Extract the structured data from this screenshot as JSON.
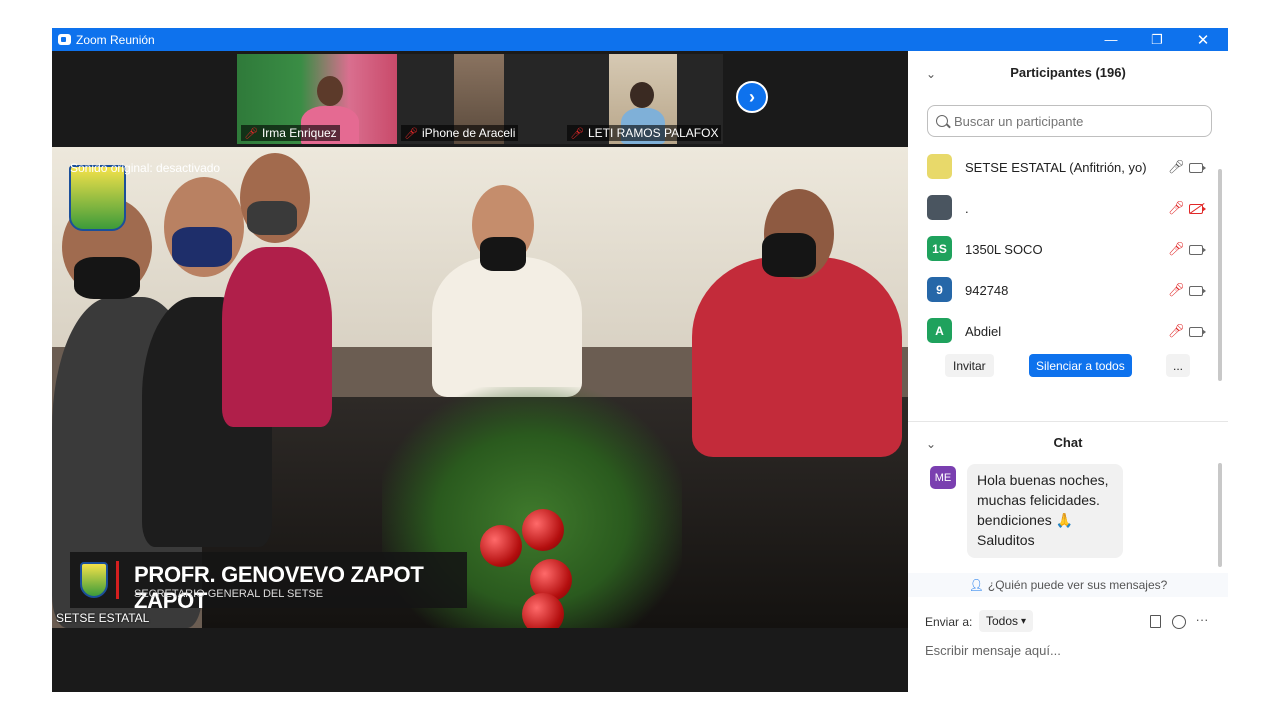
{
  "window": {
    "title": "Zoom Reunión"
  },
  "titlebar_controls": {
    "minimize": "—",
    "maximize": "❐",
    "close": "✕"
  },
  "thumbnails": [
    {
      "name": "Irma Enriquez",
      "muted": true
    },
    {
      "name": "iPhone de Araceli",
      "muted": true
    },
    {
      "name": "LETI RAMOS PALAFOX",
      "muted": true
    }
  ],
  "main_video": {
    "original_sound": "Sonido original: desactivado",
    "lower_third_name": "PROFR. GENOVEVO ZAPOT ZAPOT",
    "lower_third_role": "SECRETARIO GENERAL DEL SETSE",
    "speaker_label": "SETSE ESTATAL"
  },
  "participants": {
    "title": "Participantes (196)",
    "search_placeholder": "Buscar un participante",
    "items": [
      {
        "initials": "",
        "avatar_color": "#e8d96a",
        "name": "SETSE ESTATAL (Anfitrión, yo)",
        "mic": "on",
        "cam": "on"
      },
      {
        "initials": "",
        "avatar_color": "#4a5560",
        "name": ".",
        "mic": "off",
        "cam": "off"
      },
      {
        "initials": "1S",
        "avatar_color": "#1fa25d",
        "name": "1350L SOCO",
        "mic": "off",
        "cam": "on"
      },
      {
        "initials": "9",
        "avatar_color": "#2667a8",
        "name": "942748",
        "mic": "off",
        "cam": "on"
      },
      {
        "initials": "A",
        "avatar_color": "#1fa25d",
        "name": "Abdiel",
        "mic": "off",
        "cam": "on"
      }
    ],
    "invite_label": "Invitar",
    "mute_all_label": "Silenciar a todos",
    "more_label": "..."
  },
  "chat": {
    "title": "Chat",
    "message": {
      "avatar_initials": "ME",
      "lines": [
        "Hola buenas noches,",
        "muchas felicidades.",
        "bendiciones 🙏",
        "Saluditos"
      ]
    },
    "who_can_see": "¿Quién puede ver sus mensajes?",
    "send_to_label": "Enviar a:",
    "send_to_value": "Todos",
    "input_placeholder": "Escribir mensaje aquí...",
    "more_label": "···"
  },
  "colors": {
    "zoom_blue": "#0e72ed",
    "muted_red": "#e02828",
    "avatar_purple": "#7a3fb0"
  }
}
